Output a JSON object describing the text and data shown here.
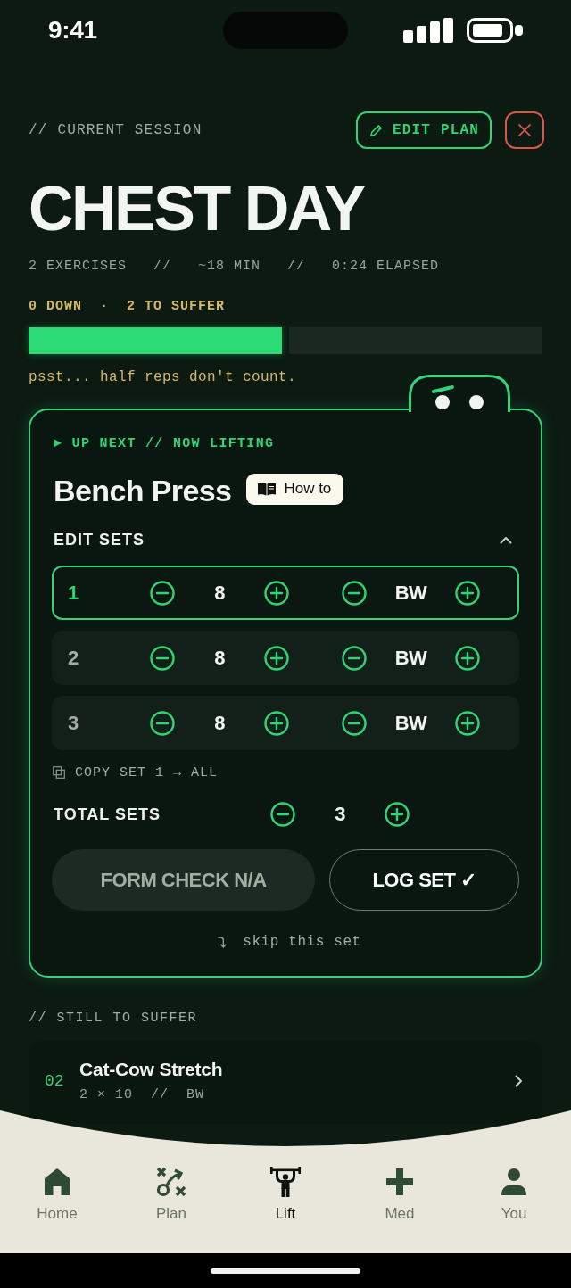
{
  "status_bar": {
    "time": "9:41"
  },
  "header": {
    "eyebrow": "// CURRENT SESSION",
    "edit_button": "EDIT PLAN",
    "title": "CHEST DAY",
    "meta": "2 EXERCISES   //   ~18 MIN   //   0:24 ELAPSED"
  },
  "progress": {
    "label": "0 DOWN  ·  2 TO SUFFER",
    "segments": [
      {
        "active": true
      },
      {
        "active": false
      }
    ],
    "tip": "psst... half reps don't count."
  },
  "current_exercise": {
    "eyebrow": "► UP NEXT // NOW LIFTING",
    "name": "Bench Press",
    "how_to_button": "How to",
    "edit_sets": {
      "label": "EDIT SETS",
      "expanded": true
    },
    "sets": [
      {
        "number": "1",
        "reps": "8",
        "weight": "BW",
        "selected": true
      },
      {
        "number": "2",
        "reps": "8",
        "weight": "BW",
        "selected": false
      },
      {
        "number": "3",
        "reps": "8",
        "weight": "BW",
        "selected": false
      }
    ],
    "copy_action": "COPY SET 1 → ALL",
    "total_sets": {
      "label": "TOTAL SETS",
      "value": "3"
    },
    "form_check_button": {
      "label": "FORM CHECK N/A",
      "disabled": true
    },
    "log_button": "LOG SET ✓",
    "skip_link": "skip this set"
  },
  "upcoming": {
    "heading": "// STILL TO SUFFER",
    "exercises": [
      {
        "number": "02",
        "name": "Cat-Cow Stretch",
        "detail": "2 × 10  //  BW"
      }
    ]
  },
  "tab_bar": {
    "tabs": [
      {
        "label": "Home",
        "selected": false
      },
      {
        "label": "Plan",
        "selected": false
      },
      {
        "label": "Lift",
        "selected": true
      },
      {
        "label": "Med",
        "selected": false
      },
      {
        "label": "You",
        "selected": false
      }
    ]
  }
}
